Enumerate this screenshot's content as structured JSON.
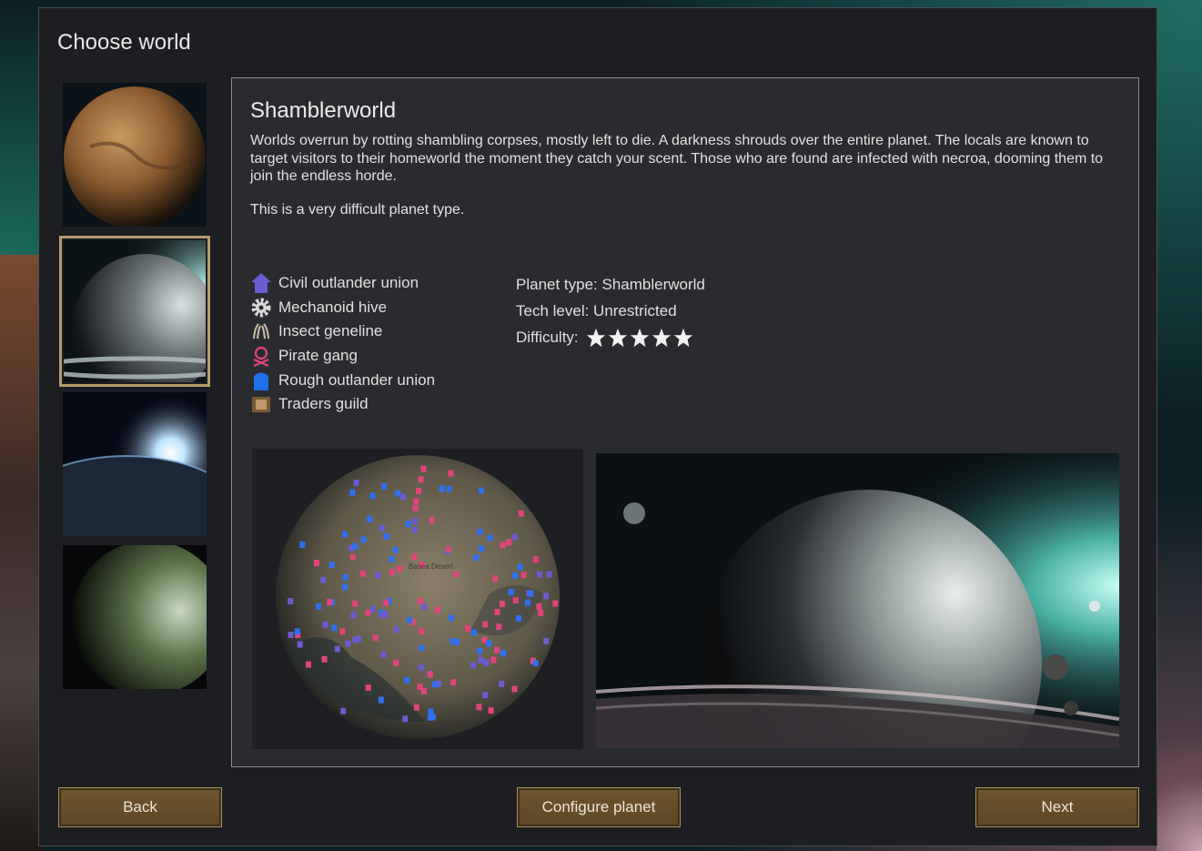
{
  "dialog": {
    "title": "Choose world"
  },
  "thumbnails": [
    {
      "name": "desert-planet",
      "selected": false
    },
    {
      "name": "shamblerworld-planet",
      "selected": true
    },
    {
      "name": "sunrise-planet",
      "selected": false
    },
    {
      "name": "temperate-planet",
      "selected": false
    }
  ],
  "world": {
    "name": "Shamblerworld",
    "description": "Worlds overrun by rotting shambling corpses, mostly left to die. A darkness shrouds over the entire planet. The locals are known to target visitors to their homeworld the moment they catch your scent. Those who are found are infected with necroa, dooming them to join the endless horde.",
    "difficulty_note": "This is a very difficult planet type."
  },
  "factions": [
    {
      "label": "Civil outlander union",
      "icon": "civil-outlander-icon",
      "color": "#6a5bd0"
    },
    {
      "label": "Mechanoid hive",
      "icon": "mechanoid-gear-icon",
      "color": "#d8d8d8"
    },
    {
      "label": "Insect geneline",
      "icon": "insect-icon",
      "color": "#c8c0a8"
    },
    {
      "label": "Pirate gang",
      "icon": "pirate-skull-icon",
      "color": "#e0457a"
    },
    {
      "label": "Rough outlander union",
      "icon": "rough-outlander-icon",
      "color": "#1f6fe8"
    },
    {
      "label": "Traders guild",
      "icon": "traders-guild-icon",
      "color": "#a88050"
    }
  ],
  "info": {
    "planet_type_label": "Planet type: Shamblerworld",
    "tech_level_label": "Tech level: Unrestricted",
    "difficulty_label": "Difficulty:",
    "difficulty_stars": 5
  },
  "map": {
    "region_label": "Basea Desert"
  },
  "buttons": {
    "back": "Back",
    "configure": "Configure planet",
    "next": "Next"
  },
  "colors": {
    "accent_border": "#b89a6a",
    "button_bg": "#6c5530"
  }
}
